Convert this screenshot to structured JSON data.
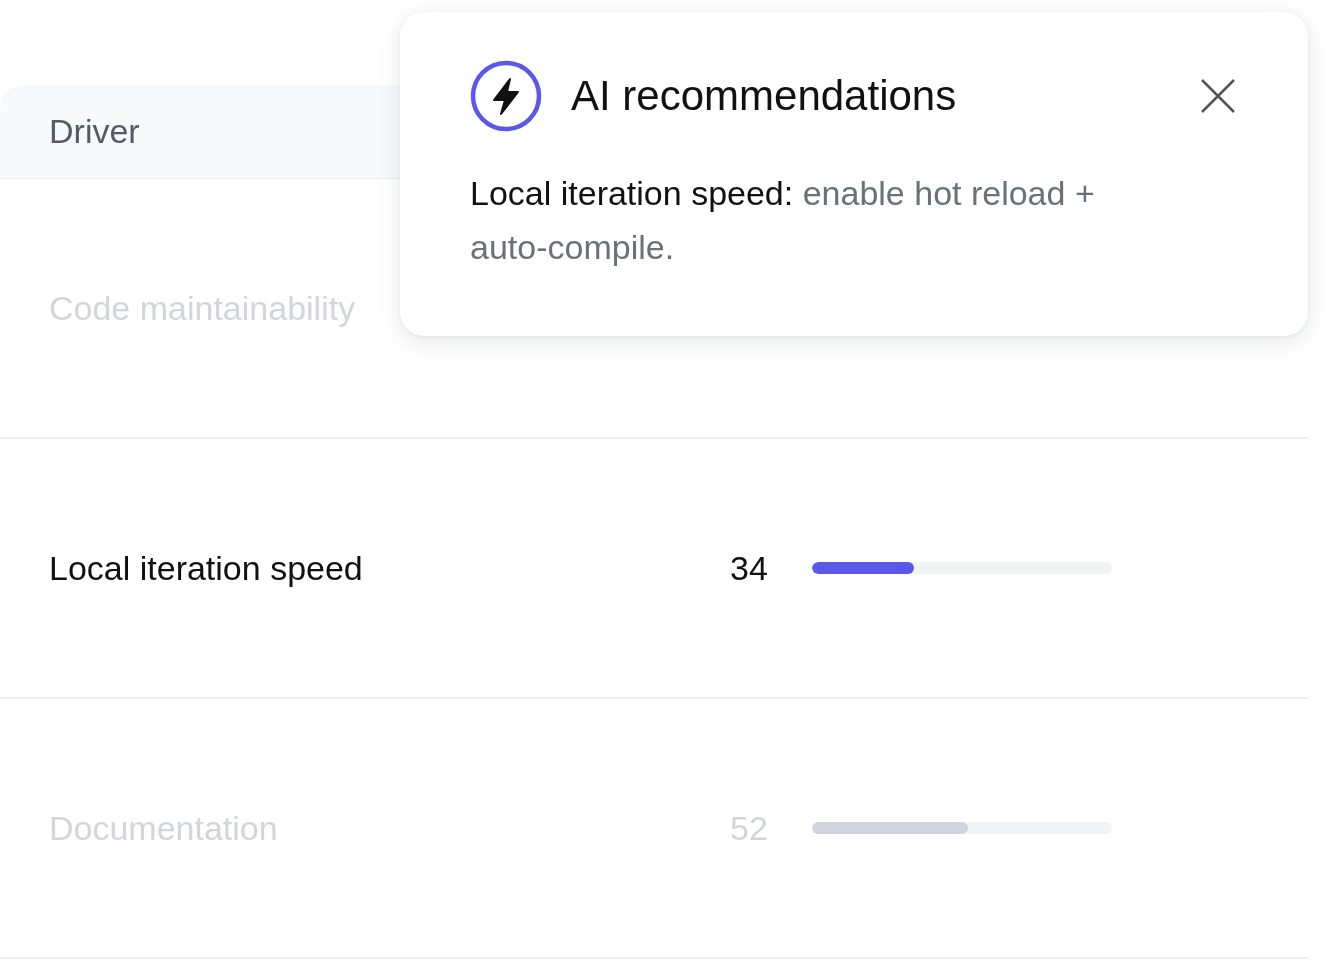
{
  "table": {
    "columns": [
      "Driver"
    ],
    "rows": [
      {
        "name": "Code maintainability",
        "dimmed": true
      },
      {
        "name": "Local iteration speed",
        "dimmed": false,
        "score": "34",
        "level": 0.34
      },
      {
        "name": "Documentation",
        "dimmed": true,
        "score": "52",
        "level": 0.52
      }
    ]
  },
  "popup": {
    "title": "AI recommendations",
    "lead": "Local iteration speed:",
    "body": "enable hot reload + auto-compile."
  }
}
